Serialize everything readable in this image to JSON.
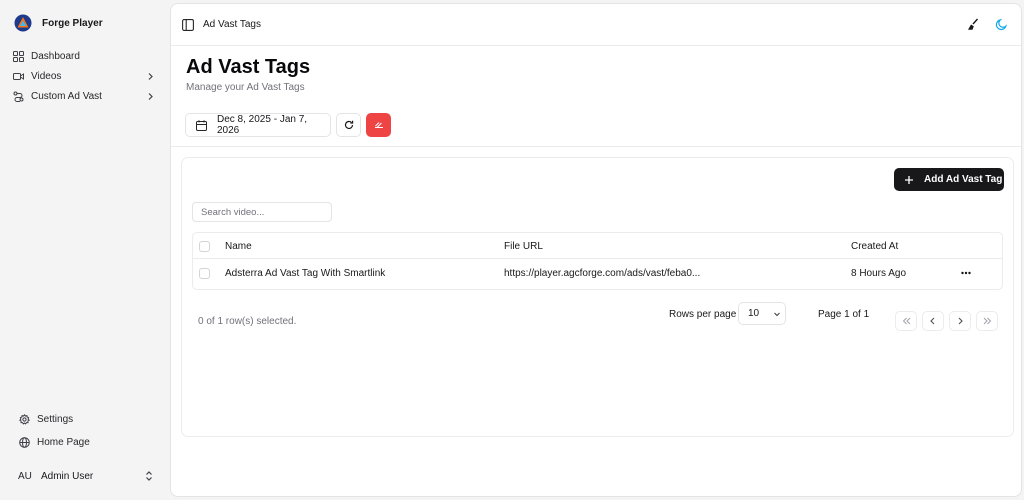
{
  "app": {
    "name": "Forge Player"
  },
  "sidebar": {
    "items": [
      {
        "label": "Dashboard",
        "icon": "dashboard-grid-icon"
      },
      {
        "label": "Videos",
        "icon": "video-camera-icon"
      },
      {
        "label": "Custom Ad Vast",
        "icon": "route-icon"
      }
    ],
    "bottom_items": [
      {
        "label": "Settings",
        "icon": "gear-icon"
      },
      {
        "label": "Home Page",
        "icon": "globe-icon"
      }
    ],
    "user": {
      "initials": "AU",
      "name": "Admin User"
    }
  },
  "header": {
    "breadcrumb": "Ad Vast Tags"
  },
  "page": {
    "title": "Ad Vast Tags",
    "subtitle": "Manage your Ad Vast Tags",
    "date_range": "Dec 8, 2025 - Jan 7, 2026"
  },
  "toolbar": {
    "add_label": "Add Ad Vast Tag"
  },
  "search": {
    "placeholder": "Search video..."
  },
  "table": {
    "columns": [
      "Name",
      "File URL",
      "Created At"
    ],
    "rows": [
      {
        "name": "Adsterra Ad Vast Tag With Smartlink",
        "file_url": "https://player.agcforge.com/ads/vast/feba0...",
        "created_at": "8 Hours Ago"
      }
    ]
  },
  "footer": {
    "selected_info": "0 of 1 row(s) selected.",
    "rows_per_page_label": "Rows per page",
    "rows_per_page_value": "10",
    "page_info": "Page 1 of 1"
  },
  "colors": {
    "accent": "#18181b",
    "danger": "#ef4444",
    "moon": "#0ea5e9"
  }
}
